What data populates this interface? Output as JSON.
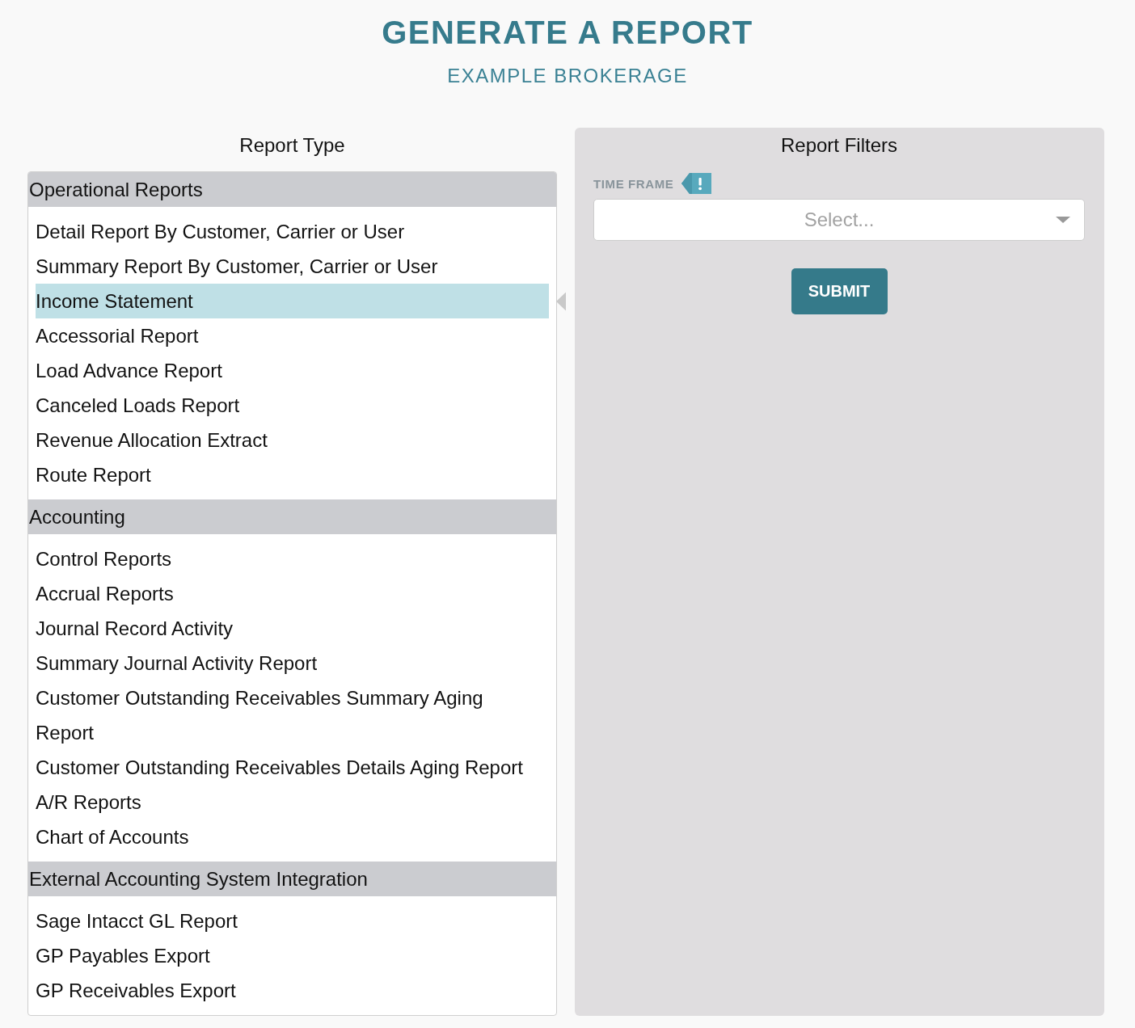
{
  "page": {
    "title": "GENERATE A REPORT",
    "subtitle": "EXAMPLE BROKERAGE"
  },
  "report_type": {
    "heading": "Report Type",
    "groups": [
      {
        "label": "Operational Reports",
        "items": [
          {
            "label": "Detail Report By Customer, Carrier or User",
            "selected": false
          },
          {
            "label": "Summary Report By Customer, Carrier or User",
            "selected": false
          },
          {
            "label": "Income Statement",
            "selected": true
          },
          {
            "label": "Accessorial Report",
            "selected": false
          },
          {
            "label": "Load Advance Report",
            "selected": false
          },
          {
            "label": "Canceled Loads Report",
            "selected": false
          },
          {
            "label": "Revenue Allocation Extract",
            "selected": false
          },
          {
            "label": "Route Report",
            "selected": false
          }
        ]
      },
      {
        "label": "Accounting",
        "items": [
          {
            "label": "Control Reports",
            "selected": false
          },
          {
            "label": "Accrual Reports",
            "selected": false
          },
          {
            "label": "Journal Record Activity",
            "selected": false
          },
          {
            "label": "Summary Journal Activity Report",
            "selected": false
          },
          {
            "label": "Customer Outstanding Receivables Summary Aging Report",
            "selected": false
          },
          {
            "label": "Customer Outstanding Receivables Details Aging Report",
            "selected": false
          },
          {
            "label": "A/R Reports",
            "selected": false
          },
          {
            "label": "Chart of Accounts",
            "selected": false
          }
        ]
      },
      {
        "label": "External Accounting System Integration",
        "items": [
          {
            "label": "Sage Intacct GL Report",
            "selected": false
          },
          {
            "label": "GP Payables Export",
            "selected": false
          },
          {
            "label": "GP Receivables Export",
            "selected": false
          }
        ]
      }
    ]
  },
  "report_filters": {
    "heading": "Report Filters",
    "time_frame": {
      "label": "TIME FRAME",
      "required": true,
      "placeholder": "Select..."
    },
    "submit_button": "SUBMIT"
  }
}
